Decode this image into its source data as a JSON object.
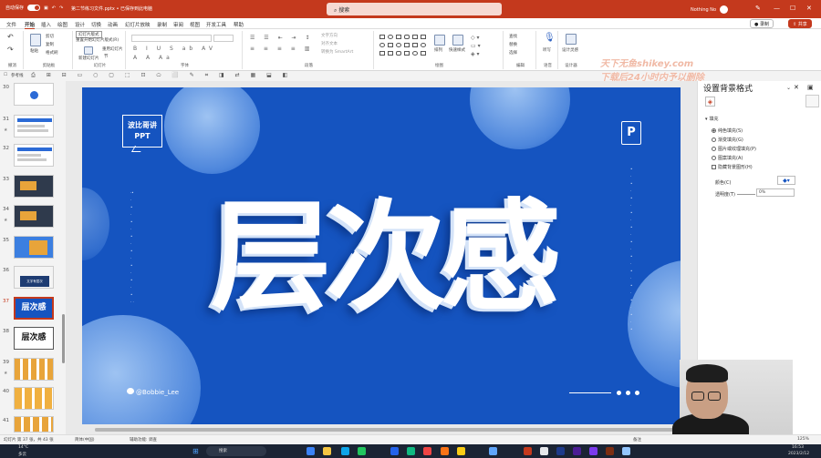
{
  "titlebar": {
    "autosave": "自动保存",
    "file_name": "第二节练习文件.pptx • 已保存到此电脑",
    "search_placeholder": "搜索",
    "user_name": "Nothing No",
    "minimize": "—",
    "maximize": "☐",
    "close": "✕"
  },
  "menu": {
    "tabs": [
      "文件",
      "开始",
      "插入",
      "绘图",
      "设计",
      "切换",
      "动画",
      "幻灯片放映",
      "录制",
      "审阅",
      "视图",
      "开发工具",
      "帮助"
    ],
    "record": "录制",
    "share": "共享"
  },
  "ribbon": {
    "groups": [
      "撤消",
      "剪贴板",
      "幻灯片",
      "字体",
      "段落",
      "绘图",
      "编辑",
      "语音",
      "设计器"
    ],
    "paste": "粘贴",
    "cut": "剪切",
    "copy": "复制",
    "format_painter": "格式刷",
    "new_slide": "新建幻灯片",
    "layout_hint": "幻灯片版式",
    "reset": "重置开始幻灯片版式(R)",
    "reuse": "重用幻灯片",
    "section": "节",
    "text_direction": "文字方向",
    "align_text": "对齐文本",
    "smartart": "转换为 SmartArt",
    "arrange": "排列",
    "quick_styles": "快速样式",
    "find": "查找",
    "replace": "替换",
    "select": "选择",
    "dictate": "听写",
    "designer": "设计灵感"
  },
  "qat": {
    "ref_line": "参考线"
  },
  "watermark": {
    "line1": "天下无鱼shikey.com",
    "line2": "下载后24小时内予以删除"
  },
  "thumbnails": [
    {
      "num": "30",
      "title": ""
    },
    {
      "num": "31",
      "title": ""
    },
    {
      "num": "32",
      "title": ""
    },
    {
      "num": "33",
      "title": ""
    },
    {
      "num": "34",
      "title": ""
    },
    {
      "num": "35",
      "title": ""
    },
    {
      "num": "36",
      "title": "文字有层次"
    },
    {
      "num": "37",
      "title": "层次感"
    },
    {
      "num": "38",
      "title": "层次感"
    },
    {
      "num": "39",
      "title": ""
    },
    {
      "num": "40",
      "title": ""
    },
    {
      "num": "41",
      "title": ""
    }
  ],
  "slide": {
    "logo_text": "波比哥讲PPT",
    "p_icon": "P",
    "title": "层次感",
    "handle": "@Bobbie_Lee"
  },
  "format_pane": {
    "title": "设置背景格式",
    "section": "填充",
    "options": [
      "纯色填充(S)",
      "渐变填充(G)",
      "图片或纹理填充(P)",
      "图案填充(A)"
    ],
    "hide_bg": "隐藏背景图形(H)",
    "color_label": "颜色(C)",
    "transparency_label": "透明度(T)",
    "transparency_value": "0%"
  },
  "statusbar": {
    "slide_info": "幻灯片 第 37 张，共 43 张",
    "language": "简体(中国)",
    "accessibility": "辅助功能: 调查",
    "notes": "备注",
    "zoom": "125%"
  },
  "taskbar": {
    "weather_temp": "14°C",
    "weather_desc": "多云",
    "search": "搜索",
    "time": "16:53",
    "date": "2023/2/12"
  }
}
